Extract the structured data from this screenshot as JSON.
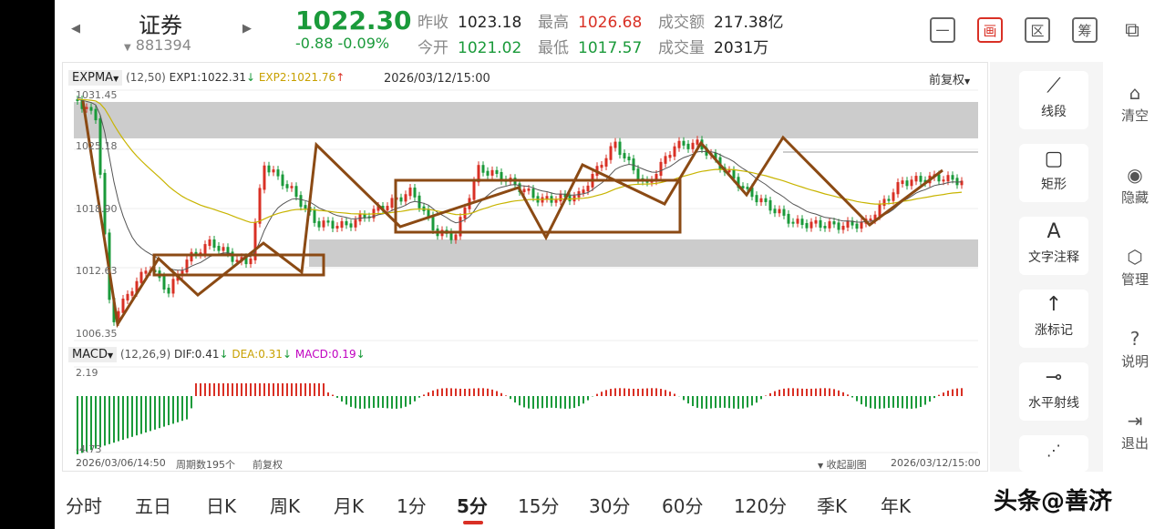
{
  "header": {
    "name": "证券",
    "code": "881394",
    "price": "1022.30",
    "change": "-0.88  -0.09%",
    "stats": {
      "prev_close_label": "昨收",
      "prev_close": "1023.18",
      "open_label": "今开",
      "open": "1021.02",
      "high_label": "最高",
      "high": "1026.68",
      "low_label": "最低",
      "low": "1017.57",
      "amount_label": "成交额",
      "amount": "217.38亿",
      "volume_label": "成交量",
      "volume": "2031万"
    },
    "tools": [
      "一",
      "画",
      "区",
      "筹",
      "⧉"
    ]
  },
  "main_chart": {
    "indicator": "EXPMA",
    "params": "(12,50)",
    "exp1": "EXP1:1022.31",
    "exp2": "EXP2:1021.76",
    "datetime": "2026/03/12/15:00",
    "adjust": "前复权",
    "y_labels": [
      "1031.45",
      "1025.18",
      "1018.90",
      "1012.63",
      "1006.35"
    ]
  },
  "sub_chart": {
    "indicator": "MACD",
    "params": "(12,26,9)",
    "dif": "DIF:0.41",
    "dea": "DEA:0.31",
    "macd": "MACD:0.19",
    "y_top": "2.19",
    "y_bottom": "-4.73"
  },
  "footer": {
    "start": "2026/03/06/14:50",
    "count": "周期数195个",
    "adjust": "前复权",
    "collapse": "收起副图",
    "end": "2026/03/12/15:00"
  },
  "draw_tools": [
    {
      "icon": "⟋",
      "label": "线段"
    },
    {
      "icon": "▢",
      "label": "矩形"
    },
    {
      "icon": "A",
      "label": "文字注释"
    },
    {
      "icon": "↑",
      "label": "涨标记"
    },
    {
      "icon": "⊸",
      "label": "水平射线"
    }
  ],
  "side_actions": [
    {
      "icon": "⌂",
      "label": "清空"
    },
    {
      "icon": "◉",
      "label": "隐藏"
    },
    {
      "icon": "⬡",
      "label": "管理"
    },
    {
      "icon": "?",
      "label": "说明"
    },
    {
      "icon": "⇥",
      "label": "退出"
    }
  ],
  "tabs": [
    "分时",
    "五日",
    "日K",
    "周K",
    "月K",
    "1分",
    "5分",
    "15分",
    "30分",
    "60分",
    "120分",
    "季K",
    "年K"
  ],
  "active_tab": "5分",
  "watermark": "头条@善济",
  "colors": {
    "up": "#d93025",
    "down": "#1a9a3a",
    "exp1": "#555555",
    "exp2": "#c8b400",
    "drawing": "#8b4a14",
    "zone": "#cccccc"
  }
}
